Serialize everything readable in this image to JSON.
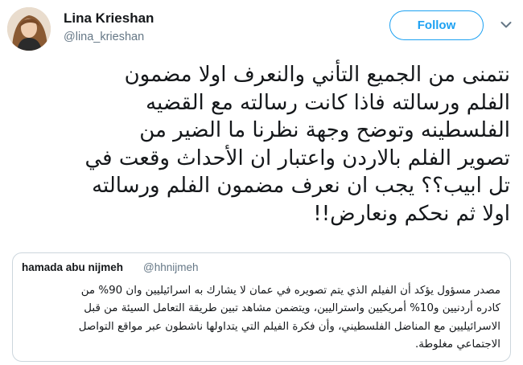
{
  "author": {
    "display_name": "Lina Krieshan",
    "handle": "@lina_krieshan"
  },
  "follow_button": {
    "label": "Follow"
  },
  "tweet": {
    "lines": [
      "نتمنى من الجميع التأني والنعرف اولا مضمون",
      "الفلم ورسالته فاذا كانت رسالته مع القضيه",
      "الفلسطينه وتوضح وجهة نظرنا ما الضير من",
      "تصوير الفلم بالاردن واعتبار ان الأحداث وقعت في",
      "تل ابيب؟؟ يجب ان نعرف مضمون الفلم ورسالته",
      "اولا ثم نحكم ونعارض!!"
    ]
  },
  "quoted_tweet": {
    "display_name": "hamada abu nijmeh",
    "handle": "@hhnijmeh",
    "lines": [
      "مصدر مسؤول يؤكد أن الفيلم الذي يتم تصويره في عمان لا يشارك به اسرائيليين وان 90% من",
      "كادره أردنيين و10% أمريكيين واستراليين، ويتضمن مشاهد تبين طريقة التعامل السيئة من قبل",
      "الاسرائيليين مع المناضل الفلسطيني، وأن فكرة الفيلم التي يتداولها ناشطون عبر مواقع التواصل",
      "الاجتماعي مغلوطة."
    ]
  },
  "colors": {
    "accent": "#1da1f2",
    "secondary_text": "#657786",
    "border": "#ccd6dd"
  },
  "icons": {
    "avatar": "profile-photo",
    "menu": "chevron-down-icon"
  }
}
